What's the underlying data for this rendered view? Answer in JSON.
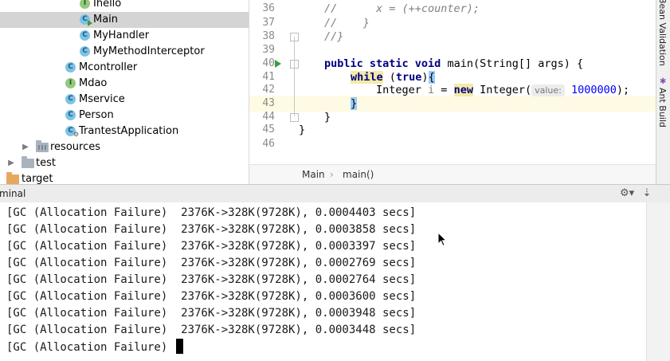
{
  "project_tree": {
    "items": [
      {
        "label": "Ihello",
        "icon": "interface-icon",
        "badge": "I"
      },
      {
        "label": "Main",
        "icon": "class-run-icon",
        "badge": "C",
        "selected": true
      },
      {
        "label": "MyHandler",
        "icon": "class-icon",
        "badge": "C"
      },
      {
        "label": "MyMethodInterceptor",
        "icon": "class-icon",
        "badge": "C"
      },
      {
        "label": "Mcontroller",
        "icon": "class-icon",
        "badge": "C"
      },
      {
        "label": "Mdao",
        "icon": "interface-icon",
        "badge": "I"
      },
      {
        "label": "Mservice",
        "icon": "class-icon",
        "badge": "C"
      },
      {
        "label": "Person",
        "icon": "class-icon",
        "badge": "C"
      },
      {
        "label": "TrantestApplication",
        "icon": "spring-class-icon",
        "badge": "C"
      },
      {
        "label": "resources",
        "icon": "resources-folder-icon"
      },
      {
        "label": "test",
        "icon": "folder-icon"
      },
      {
        "label": "target",
        "icon": "excluded-folder-icon"
      }
    ]
  },
  "editor": {
    "lines": [
      {
        "n": "36",
        "text": "//      x = (++counter);"
      },
      {
        "n": "37",
        "text": "//    }"
      },
      {
        "n": "38",
        "text": "//}"
      },
      {
        "n": "39",
        "text": ""
      },
      {
        "n": "40",
        "kw1": "public static void",
        "rest": " main(String[] args) {"
      },
      {
        "n": "41",
        "kw1": "while",
        "paren": " (",
        "kw2": "true",
        "close": ")",
        "brace": "{"
      },
      {
        "n": "42",
        "type": "Integer ",
        "var": "i",
        "eq": " = ",
        "kw": "new",
        "ctor": " Integer(",
        "hint": "value:",
        "num": "1000000",
        "end": ");"
      },
      {
        "n": "43",
        "text": "}"
      },
      {
        "n": "44",
        "text": "}"
      },
      {
        "n": "45",
        "text": "}"
      },
      {
        "n": "46",
        "text": ""
      }
    ],
    "breadcrumb": [
      "Main",
      "main()"
    ]
  },
  "right_strip": {
    "tabs": [
      "Bean Validation",
      "Ant Build"
    ]
  },
  "terminal": {
    "title": "minal",
    "lines": [
      "[GC (Allocation Failure)  2376K->328K(9728K), 0.0004403 secs]",
      "[GC (Allocation Failure)  2376K->328K(9728K), 0.0003858 secs]",
      "[GC (Allocation Failure)  2376K->328K(9728K), 0.0003397 secs]",
      "[GC (Allocation Failure)  2376K->328K(9728K), 0.0002769 secs]",
      "[GC (Allocation Failure)  2376K->328K(9728K), 0.0002764 secs]",
      "[GC (Allocation Failure)  2376K->328K(9728K), 0.0003600 secs]",
      "[GC (Allocation Failure)  2376K->328K(9728K), 0.0003948 secs]",
      "[GC (Allocation Failure)  2376K->328K(9728K), 0.0003448 secs]",
      "[GC (Allocation Failure) "
    ]
  }
}
